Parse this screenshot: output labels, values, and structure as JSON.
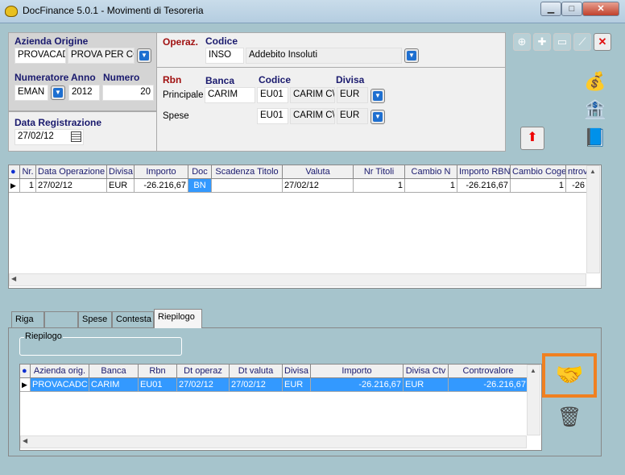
{
  "window": {
    "title": "DocFinance 5.0.1  -  Movimenti di Tesoreria",
    "minimize": "▁",
    "maximize": "□",
    "close": "✕"
  },
  "form": {
    "azienda_label": "Azienda Origine",
    "azienda_code": "PROVACAD",
    "azienda_desc": "PROVA PER CO",
    "numeratore_label": "Numeratore",
    "anno_label": "Anno",
    "numero_label": "Numero",
    "numeratore": "EMAN",
    "anno": "2012",
    "numero": "20",
    "data_label": "Data Registrazione",
    "data": "27/02/12",
    "operaz_label": "Operaz.",
    "codice_label": "Codice",
    "operaz_code": "INSO",
    "operaz_desc": "Addebito Insoluti",
    "rbn_label": "Rbn",
    "banca_label": "Banca",
    "codice2_label": "Codice",
    "divisa_label": "Divisa",
    "principale_label": "Principale",
    "principale_banca": "CARIM",
    "principale_codice": "EU01",
    "principale_desc": "CARIM C\\C",
    "principale_divisa": "EUR",
    "spese_label": "Spese",
    "spese_codice": "EU01",
    "spese_desc": "CARIM C\\C",
    "spese_divisa": "EUR"
  },
  "grid1": {
    "columns": [
      "Nr.",
      "Data Operazione",
      "Divisa",
      "Importo",
      "Doc",
      "Scadenza Titolo",
      "Valuta",
      "Nr Titoli",
      "Cambio N",
      "Importo RBN",
      "Cambio Coge",
      "ntrova"
    ],
    "rows": [
      [
        "1",
        "27/02/12",
        "EUR",
        "-26.216,67",
        "BN",
        "",
        "27/02/12",
        "1",
        "1",
        "-26.216,67",
        "1",
        "-26"
      ]
    ]
  },
  "tabs": [
    "Riga",
    "",
    "Spese",
    "Contesta",
    "Riepilogo"
  ],
  "active_tab": "Riepilogo",
  "riepilogo_group": "Riepilogo",
  "grid2": {
    "columns": [
      "Azienda orig.",
      "Banca",
      "Rbn",
      "Dt operaz",
      "Dt valuta",
      "Divisa",
      "Importo",
      "Divisa Ctv",
      "Controvalore"
    ],
    "rows": [
      [
        "PROVACADC",
        "CARIM",
        "EU01",
        "27/02/12",
        "27/02/12",
        "EUR",
        "-26.216,67",
        "EUR",
        "-26.216,67"
      ]
    ]
  },
  "colors": {
    "background": "#a6c4cc",
    "selection": "#3399ff",
    "highlight_border": "#f08020"
  }
}
